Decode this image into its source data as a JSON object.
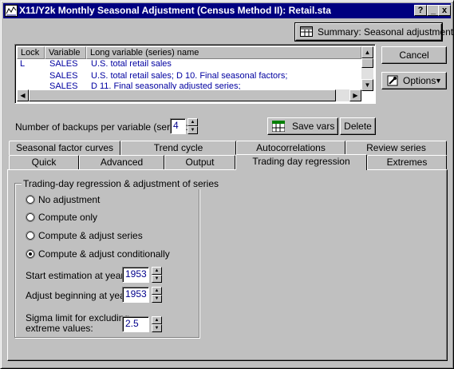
{
  "window": {
    "title": "X11/Y2k Monthly Seasonal Adjustment (Census Method II): Retail.sta",
    "help_label": "?",
    "minimize_label": "_",
    "close_label": "x"
  },
  "buttons": {
    "summary": "Summary:  Seasonal adjustment",
    "cancel": "Cancel",
    "options": "Options",
    "save_vars": "Save vars",
    "delete": "Delete"
  },
  "variable_list": {
    "columns": [
      "Lock",
      "Variable",
      "Long variable (series) name"
    ],
    "rows": [
      {
        "lock": "L",
        "variable": "SALES",
        "name": "U.S. total retail sales"
      },
      {
        "lock": "",
        "variable": "SALES",
        "name": "U.S. total retail sales; D 10. Final seasonal factors;"
      },
      {
        "lock": "",
        "variable": "SALES",
        "name": "D 11. Final seasonally adjusted series;"
      }
    ]
  },
  "backups": {
    "label": "Number of backups per variable (series):",
    "value": "4"
  },
  "tabs_row1": [
    "Seasonal factor curves",
    "Trend cycle",
    "Autocorrelations",
    "Review series"
  ],
  "tabs_row2": [
    "Quick",
    "Advanced",
    "Output",
    "Trading day regression",
    "Extremes"
  ],
  "active_tab": "Trading day regression",
  "trading_day": {
    "group_title": "Trading-day regression & adjustment of series",
    "options": [
      "No adjustment",
      "Compute only",
      "Compute & adjust series",
      "Compute & adjust conditionally"
    ],
    "selected_index": 3,
    "start_label": "Start estimation at year:",
    "start_value": "1953",
    "adjust_label": "Adjust beginning at year:",
    "adjust_value": "1953",
    "sigma_label_1": "Sigma limit for excluding",
    "sigma_label_2": "extreme values:",
    "sigma_value": "2.5"
  }
}
